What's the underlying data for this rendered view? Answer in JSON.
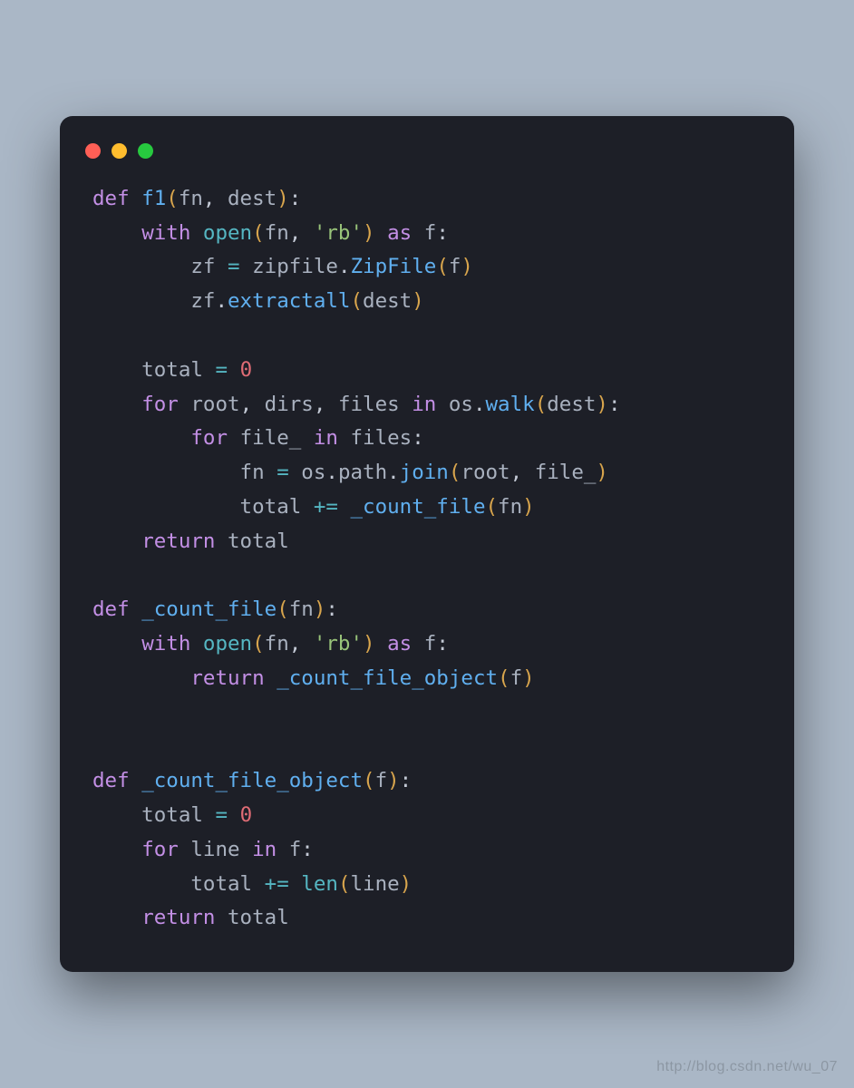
{
  "colors": {
    "background_outer": "#aab7c6",
    "background_window": "#1d1f27",
    "dot_red": "#ff5f56",
    "dot_yellow": "#ffbd2e",
    "dot_green": "#27c93f",
    "keyword": "#c38fe5",
    "function_name": "#60afef",
    "builtin": "#55b6c2",
    "identifier": "#a9b1bf",
    "operator": "#55b6c2",
    "paren": "#d8a54d",
    "number": "#e06c75",
    "string": "#98c379",
    "plain": "#c3c9d5"
  },
  "code": {
    "language": "python",
    "lines": [
      [
        {
          "t": "def ",
          "c": "kw"
        },
        {
          "t": "f1",
          "c": "fn"
        },
        {
          "t": "(",
          "c": "gold"
        },
        {
          "t": "fn",
          "c": "id"
        },
        {
          "t": ", ",
          "c": "p"
        },
        {
          "t": "dest",
          "c": "id"
        },
        {
          "t": ")",
          "c": "gold"
        },
        {
          "t": ":",
          "c": "p"
        }
      ],
      [
        {
          "t": "    ",
          "c": "p"
        },
        {
          "t": "with ",
          "c": "kw"
        },
        {
          "t": "open",
          "c": "func"
        },
        {
          "t": "(",
          "c": "gold"
        },
        {
          "t": "fn",
          "c": "id"
        },
        {
          "t": ", ",
          "c": "p"
        },
        {
          "t": "'rb'",
          "c": "str"
        },
        {
          "t": ")",
          "c": "gold"
        },
        {
          "t": " as ",
          "c": "kw"
        },
        {
          "t": "f",
          "c": "id"
        },
        {
          "t": ":",
          "c": "p"
        }
      ],
      [
        {
          "t": "        zf ",
          "c": "id"
        },
        {
          "t": "=",
          "c": "op"
        },
        {
          "t": " zipfile",
          "c": "id"
        },
        {
          "t": ".",
          "c": "p"
        },
        {
          "t": "ZipFile",
          "c": "fn"
        },
        {
          "t": "(",
          "c": "gold"
        },
        {
          "t": "f",
          "c": "id"
        },
        {
          "t": ")",
          "c": "gold"
        }
      ],
      [
        {
          "t": "        zf",
          "c": "id"
        },
        {
          "t": ".",
          "c": "p"
        },
        {
          "t": "extractall",
          "c": "fn"
        },
        {
          "t": "(",
          "c": "gold"
        },
        {
          "t": "dest",
          "c": "id"
        },
        {
          "t": ")",
          "c": "gold"
        }
      ],
      [
        {
          "t": "",
          "c": "p"
        }
      ],
      [
        {
          "t": "    total ",
          "c": "id"
        },
        {
          "t": "=",
          "c": "op"
        },
        {
          "t": " ",
          "c": "p"
        },
        {
          "t": "0",
          "c": "num"
        }
      ],
      [
        {
          "t": "    ",
          "c": "p"
        },
        {
          "t": "for ",
          "c": "kw"
        },
        {
          "t": "root",
          "c": "id"
        },
        {
          "t": ", ",
          "c": "p"
        },
        {
          "t": "dirs",
          "c": "id"
        },
        {
          "t": ", ",
          "c": "p"
        },
        {
          "t": "files",
          "c": "id"
        },
        {
          "t": " in ",
          "c": "kw"
        },
        {
          "t": "os",
          "c": "id"
        },
        {
          "t": ".",
          "c": "p"
        },
        {
          "t": "walk",
          "c": "fn"
        },
        {
          "t": "(",
          "c": "gold"
        },
        {
          "t": "dest",
          "c": "id"
        },
        {
          "t": ")",
          "c": "gold"
        },
        {
          "t": ":",
          "c": "p"
        }
      ],
      [
        {
          "t": "        ",
          "c": "p"
        },
        {
          "t": "for ",
          "c": "kw"
        },
        {
          "t": "file_",
          "c": "id"
        },
        {
          "t": " in ",
          "c": "kw"
        },
        {
          "t": "files",
          "c": "id"
        },
        {
          "t": ":",
          "c": "p"
        }
      ],
      [
        {
          "t": "            fn ",
          "c": "id"
        },
        {
          "t": "=",
          "c": "op"
        },
        {
          "t": " os",
          "c": "id"
        },
        {
          "t": ".",
          "c": "p"
        },
        {
          "t": "path",
          "c": "id"
        },
        {
          "t": ".",
          "c": "p"
        },
        {
          "t": "join",
          "c": "fn"
        },
        {
          "t": "(",
          "c": "gold"
        },
        {
          "t": "root",
          "c": "id"
        },
        {
          "t": ", ",
          "c": "p"
        },
        {
          "t": "file_",
          "c": "id"
        },
        {
          "t": ")",
          "c": "gold"
        }
      ],
      [
        {
          "t": "            total ",
          "c": "id"
        },
        {
          "t": "+=",
          "c": "op"
        },
        {
          "t": " ",
          "c": "p"
        },
        {
          "t": "_count_file",
          "c": "fn"
        },
        {
          "t": "(",
          "c": "gold"
        },
        {
          "t": "fn",
          "c": "id"
        },
        {
          "t": ")",
          "c": "gold"
        }
      ],
      [
        {
          "t": "    ",
          "c": "p"
        },
        {
          "t": "return ",
          "c": "kw"
        },
        {
          "t": "total",
          "c": "id"
        }
      ],
      [
        {
          "t": "",
          "c": "p"
        }
      ],
      [
        {
          "t": "def ",
          "c": "kw"
        },
        {
          "t": "_count_file",
          "c": "fn"
        },
        {
          "t": "(",
          "c": "gold"
        },
        {
          "t": "fn",
          "c": "id"
        },
        {
          "t": ")",
          "c": "gold"
        },
        {
          "t": ":",
          "c": "p"
        }
      ],
      [
        {
          "t": "    ",
          "c": "p"
        },
        {
          "t": "with ",
          "c": "kw"
        },
        {
          "t": "open",
          "c": "func"
        },
        {
          "t": "(",
          "c": "gold"
        },
        {
          "t": "fn",
          "c": "id"
        },
        {
          "t": ", ",
          "c": "p"
        },
        {
          "t": "'rb'",
          "c": "str"
        },
        {
          "t": ")",
          "c": "gold"
        },
        {
          "t": " as ",
          "c": "kw"
        },
        {
          "t": "f",
          "c": "id"
        },
        {
          "t": ":",
          "c": "p"
        }
      ],
      [
        {
          "t": "        ",
          "c": "p"
        },
        {
          "t": "return ",
          "c": "kw"
        },
        {
          "t": "_count_file_object",
          "c": "fn"
        },
        {
          "t": "(",
          "c": "gold"
        },
        {
          "t": "f",
          "c": "id"
        },
        {
          "t": ")",
          "c": "gold"
        }
      ],
      [
        {
          "t": "",
          "c": "p"
        }
      ],
      [
        {
          "t": "",
          "c": "p"
        }
      ],
      [
        {
          "t": "def ",
          "c": "kw"
        },
        {
          "t": "_count_file_object",
          "c": "fn"
        },
        {
          "t": "(",
          "c": "gold"
        },
        {
          "t": "f",
          "c": "id"
        },
        {
          "t": ")",
          "c": "gold"
        },
        {
          "t": ":",
          "c": "p"
        }
      ],
      [
        {
          "t": "    total ",
          "c": "id"
        },
        {
          "t": "=",
          "c": "op"
        },
        {
          "t": " ",
          "c": "p"
        },
        {
          "t": "0",
          "c": "num"
        }
      ],
      [
        {
          "t": "    ",
          "c": "p"
        },
        {
          "t": "for ",
          "c": "kw"
        },
        {
          "t": "line",
          "c": "id"
        },
        {
          "t": " in ",
          "c": "kw"
        },
        {
          "t": "f",
          "c": "id"
        },
        {
          "t": ":",
          "c": "p"
        }
      ],
      [
        {
          "t": "        total ",
          "c": "id"
        },
        {
          "t": "+=",
          "c": "op"
        },
        {
          "t": " ",
          "c": "p"
        },
        {
          "t": "len",
          "c": "func"
        },
        {
          "t": "(",
          "c": "gold"
        },
        {
          "t": "line",
          "c": "id"
        },
        {
          "t": ")",
          "c": "gold"
        }
      ],
      [
        {
          "t": "    ",
          "c": "p"
        },
        {
          "t": "return ",
          "c": "kw"
        },
        {
          "t": "total",
          "c": "id"
        }
      ]
    ]
  },
  "watermark": "http://blog.csdn.net/wu_07"
}
